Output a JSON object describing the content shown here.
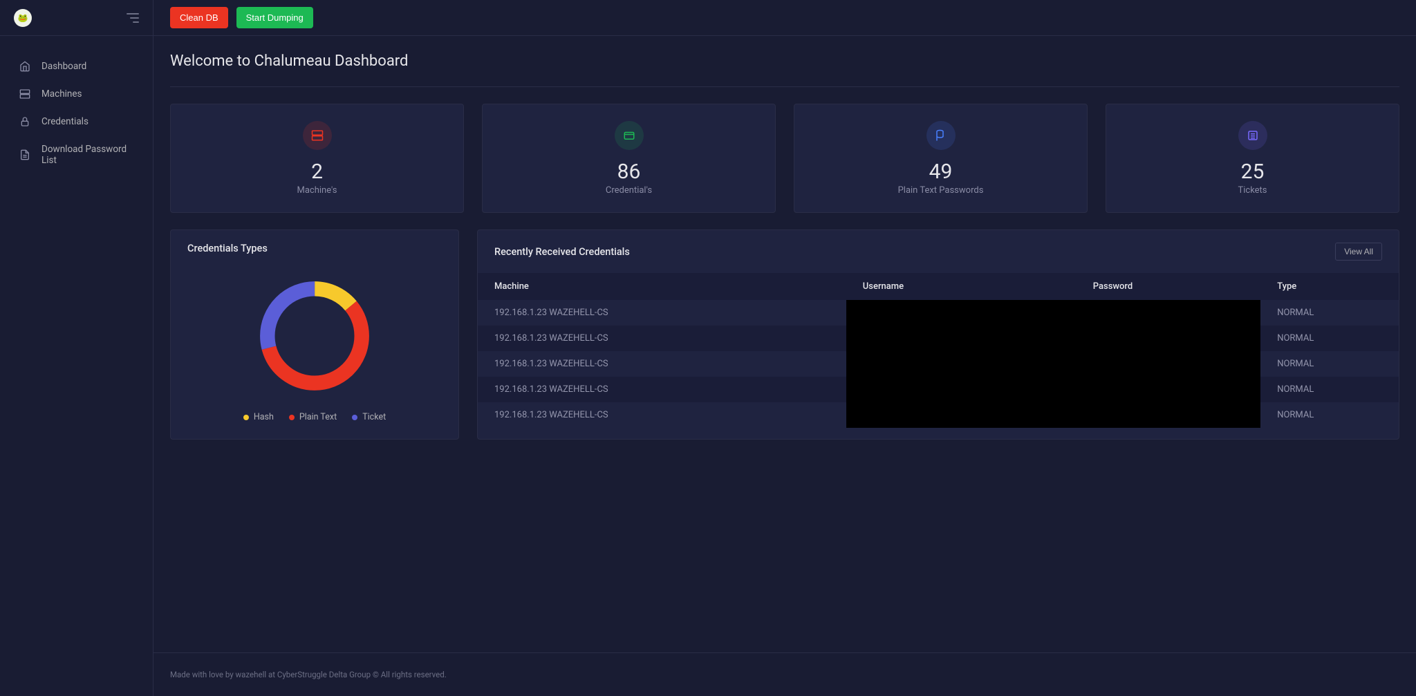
{
  "sidebar": {
    "items": [
      {
        "label": "Dashboard",
        "icon": "home"
      },
      {
        "label": "Machines",
        "icon": "server"
      },
      {
        "label": "Credentials",
        "icon": "lock"
      },
      {
        "label": "Download Password List",
        "icon": "file"
      }
    ]
  },
  "topbar": {
    "clean_db": "Clean DB",
    "start_dumping": "Start Dumping"
  },
  "page": {
    "title": "Welcome to Chalumeau Dashboard"
  },
  "stats": [
    {
      "value": "2",
      "label": "Machine's",
      "color": "red",
      "icon": "server"
    },
    {
      "value": "86",
      "label": "Credential's",
      "color": "green",
      "icon": "credential"
    },
    {
      "value": "49",
      "label": "Plain Text Passwords",
      "color": "blue",
      "icon": "flag"
    },
    {
      "value": "25",
      "label": "Tickets",
      "color": "purple",
      "icon": "list"
    }
  ],
  "chart_panel": {
    "title": "Credentials Types"
  },
  "chart_data": {
    "type": "pie",
    "title": "Credentials Types",
    "series": [
      {
        "name": "Hash",
        "value": 12,
        "color": "#f7c92c"
      },
      {
        "name": "Plain Text",
        "value": 49,
        "color": "#eb3422"
      },
      {
        "name": "Ticket",
        "value": 25,
        "color": "#5b5ed8"
      }
    ]
  },
  "table_panel": {
    "title": "Recently Received Credentials",
    "view_all": "View All",
    "columns": [
      "Machine",
      "Username",
      "Password",
      "Type"
    ],
    "rows": [
      {
        "machine": "192.168.1.23 WAZEHELL-CS",
        "type": "NORMAL"
      },
      {
        "machine": "192.168.1.23 WAZEHELL-CS",
        "type": "NORMAL"
      },
      {
        "machine": "192.168.1.23 WAZEHELL-CS",
        "type": "NORMAL"
      },
      {
        "machine": "192.168.1.23 WAZEHELL-CS",
        "type": "NORMAL"
      },
      {
        "machine": "192.168.1.23 WAZEHELL-CS",
        "type": "NORMAL"
      }
    ]
  },
  "footer": {
    "text": "Made with love by wazehell at CyberStruggle Delta Group © All rights reserved."
  }
}
